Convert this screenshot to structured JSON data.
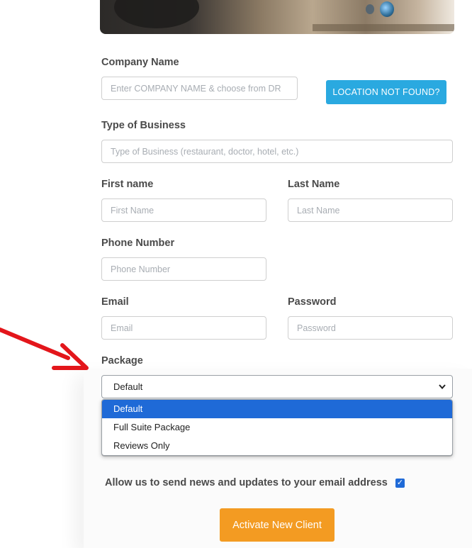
{
  "form": {
    "company_label": "Company Name",
    "company_placeholder": "Enter COMPANY NAME & choose from DR",
    "location_button": "LOCATION NOT FOUND?",
    "business_label": "Type of Business",
    "business_placeholder": "Type of Business (restaurant, doctor, hotel, etc.)",
    "first_label": "First name",
    "first_placeholder": "First Name",
    "last_label": "Last Name",
    "last_placeholder": "Last Name",
    "phone_label": "Phone Number",
    "phone_placeholder": "Phone Number",
    "email_label": "Email",
    "email_placeholder": "Email",
    "password_label": "Password",
    "password_placeholder": "Password",
    "package_label": "Package",
    "package_selected": "Default",
    "package_options": [
      "Default",
      "Full Suite Package",
      "Reviews Only"
    ],
    "consent_text": "Allow us to send news and updates to your email address",
    "consent_checked": true,
    "submit_button": "Activate New Client"
  },
  "colors": {
    "accent_blue": "#2aa9e0",
    "accent_orange": "#f39b22",
    "selected_option": "#1f6ad7",
    "annotation_arrow": "#e3161b"
  },
  "icons": {
    "select_chevron": "chevron-down-icon",
    "checkbox": "checkmark-icon",
    "annotation": "red-arrow-icon"
  }
}
